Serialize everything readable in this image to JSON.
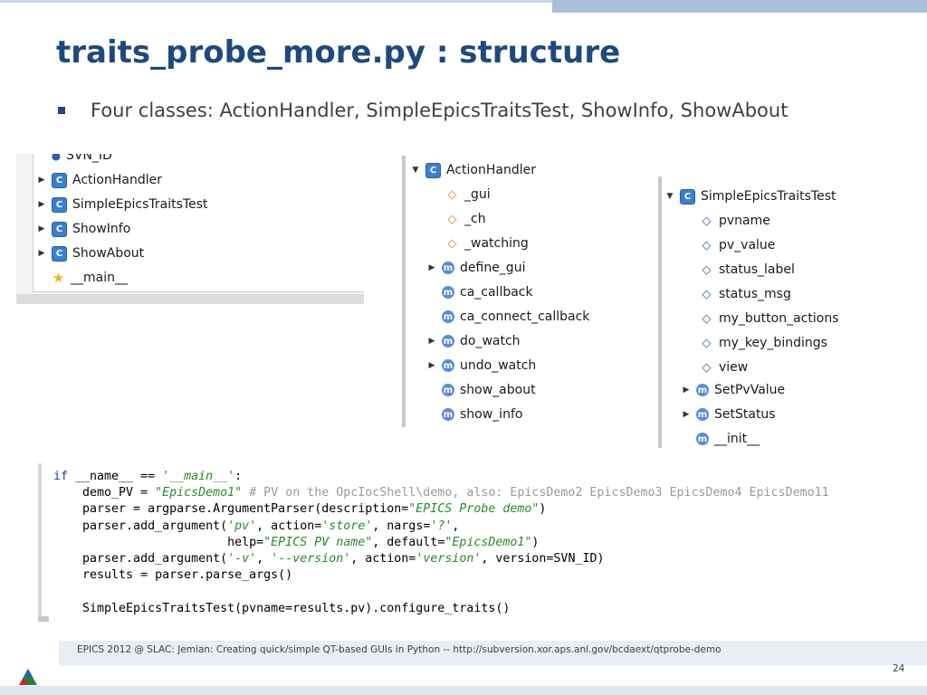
{
  "slide": {
    "title": "traits_probe_more.py : structure",
    "bullet": "Four classes: ActionHandler, SimpleEpicsTraitsTest, ShowInfo, ShowAbout"
  },
  "outline_panel": {
    "items": [
      {
        "label": "SVN_ID",
        "icon": "variable-icon",
        "expandable": false
      },
      {
        "label": "ActionHandler",
        "icon": "class-icon",
        "expandable": true
      },
      {
        "label": "SimpleEpicsTraitsTest",
        "icon": "class-icon",
        "expandable": true
      },
      {
        "label": "ShowInfo",
        "icon": "class-icon",
        "expandable": true
      },
      {
        "label": "ShowAbout",
        "icon": "class-icon",
        "expandable": true
      },
      {
        "label": "__main__",
        "icon": "main-icon",
        "expandable": false
      }
    ]
  },
  "action_handler_panel": {
    "class_label": "ActionHandler",
    "items": [
      {
        "label": "_gui",
        "icon": "private-field-icon",
        "expandable": false
      },
      {
        "label": "_ch",
        "icon": "private-field-icon",
        "expandable": false
      },
      {
        "label": "_watching",
        "icon": "private-field-icon",
        "expandable": false
      },
      {
        "label": "define_gui",
        "icon": "method-icon",
        "expandable": true
      },
      {
        "label": "ca_callback",
        "icon": "method-icon",
        "expandable": false
      },
      {
        "label": "ca_connect_callback",
        "icon": "method-icon",
        "expandable": false
      },
      {
        "label": "do_watch",
        "icon": "method-icon",
        "expandable": true
      },
      {
        "label": "undo_watch",
        "icon": "method-icon",
        "expandable": true
      },
      {
        "label": "show_about",
        "icon": "method-icon",
        "expandable": false
      },
      {
        "label": "show_info",
        "icon": "method-icon",
        "expandable": false
      }
    ]
  },
  "simple_epics_panel": {
    "class_label": "SimpleEpicsTraitsTest",
    "items": [
      {
        "label": "pvname",
        "icon": "field-icon",
        "expandable": false
      },
      {
        "label": "pv_value",
        "icon": "field-icon",
        "expandable": false
      },
      {
        "label": "status_label",
        "icon": "field-icon",
        "expandable": false
      },
      {
        "label": "status_msg",
        "icon": "field-icon",
        "expandable": false
      },
      {
        "label": "my_button_actions",
        "icon": "field-icon",
        "expandable": false
      },
      {
        "label": "my_key_bindings",
        "icon": "field-icon",
        "expandable": false
      },
      {
        "label": "view",
        "icon": "field-icon",
        "expandable": false
      },
      {
        "label": "SetPvValue",
        "icon": "method-icon",
        "expandable": true
      },
      {
        "label": "SetStatus",
        "icon": "method-icon",
        "expandable": true
      },
      {
        "label": "__init__",
        "icon": "method-icon",
        "expandable": false
      }
    ]
  },
  "footer": {
    "text": "EPICS 2012 @ SLAC: Jemian: Creating quick/simple QT-based GUIs in Python -- http://subversion.xor.aps.anl.gov/bcdaext/qtprobe-demo",
    "page": "24"
  },
  "colors": {
    "title": "#1f497d",
    "keyword": "#1f3fa8",
    "string": "#2a8a2a",
    "comment": "#9a9a9a",
    "top_bar": "#a9c0d8"
  }
}
